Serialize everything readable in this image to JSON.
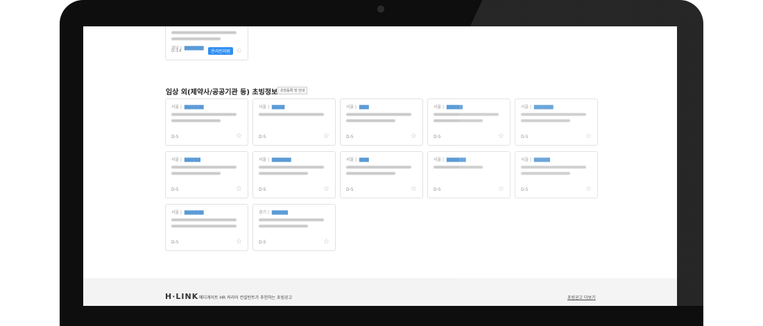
{
  "top_card": {
    "region": "경남",
    "dday": "D-14",
    "badge": "온라인지원"
  },
  "section": {
    "title": "임상 외(제약사/공공기관 등) 초빙정보",
    "tag": "초빙등록 및 안내"
  },
  "cards": [
    {
      "region": "서울",
      "dday": "D-5"
    },
    {
      "region": "서울",
      "dday": "D-5"
    },
    {
      "region": "서울",
      "dday": "D-5"
    },
    {
      "region": "서울",
      "dday": "D-5"
    },
    {
      "region": "서울",
      "dday": "D-5"
    },
    {
      "region": "서울",
      "dday": "D-5"
    },
    {
      "region": "서울",
      "dday": "D-5"
    },
    {
      "region": "서울",
      "dday": "D-5"
    },
    {
      "region": "서울",
      "dday": "D-5"
    },
    {
      "region": "서울",
      "dday": "D-5"
    },
    {
      "region": "서울",
      "dday": "D-5"
    },
    {
      "region": "경기",
      "dday": "D-5"
    }
  ],
  "footer": {
    "logo": "H·LINK",
    "text": "메디게이트 HR 커리어 컨설턴트가 추천하는 초빙공고",
    "more_link": "초빙공고 더보기"
  }
}
